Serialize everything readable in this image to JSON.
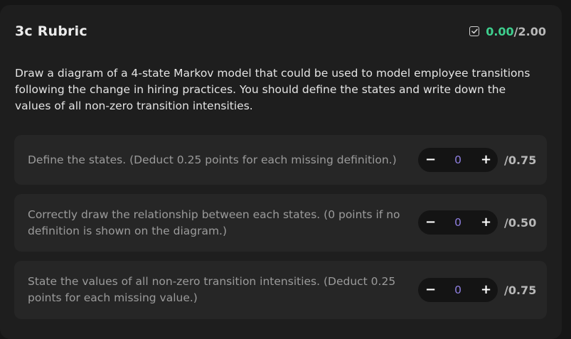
{
  "header": {
    "title": "3c Rubric",
    "score_earned": "0.00",
    "score_total": "/2.00"
  },
  "description": "Draw a diagram of a 4-state Markov model that could be used to model employee transitions following the change in hiring practices. You should define the states and write down the values of all non-zero transition intensities.",
  "criteria": [
    {
      "text": "Define the states. (Deduct 0.25 points for each missing definition.)",
      "value": "0",
      "max": "/0.75",
      "minus_label": "−",
      "plus_label": "+"
    },
    {
      "text": "Correctly draw the relationship between each states. (0 points if no definition is shown on the diagram.)",
      "value": "0",
      "max": "/0.50",
      "minus_label": "−",
      "plus_label": "+"
    },
    {
      "text": "State the values of all non-zero transition intensities. (Deduct 0.25 points for each missing value.)",
      "value": "0",
      "max": "/0.75",
      "minus_label": "−",
      "plus_label": "+"
    }
  ],
  "colors": {
    "score_earned": "#3ecf8e",
    "stepper_value": "#8f7fe0",
    "panel": "#1e1e1e",
    "criterion_bg": "#262626"
  },
  "icons": {
    "score": "checkbox-check-icon"
  }
}
